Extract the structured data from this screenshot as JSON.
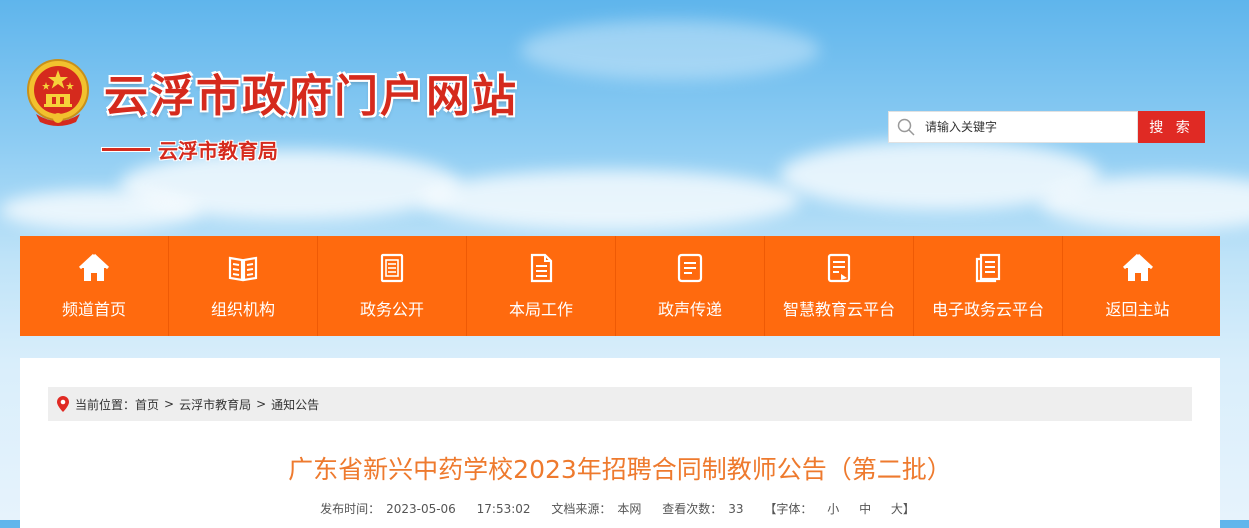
{
  "header": {
    "site_title": "云浮市政府门户网站",
    "sub_title": "云浮市教育局"
  },
  "search": {
    "placeholder": "请输入关键字",
    "button_label": "搜 索"
  },
  "nav": {
    "items": [
      {
        "label": "频道首页",
        "icon": "home-icon"
      },
      {
        "label": "组织机构",
        "icon": "book-icon"
      },
      {
        "label": "政务公开",
        "icon": "document-list-icon"
      },
      {
        "label": "本局工作",
        "icon": "file-text-icon"
      },
      {
        "label": "政声传递",
        "icon": "file-lines-icon"
      },
      {
        "label": "智慧教育云平台",
        "icon": "notepad-icon"
      },
      {
        "label": "电子政务云平台",
        "icon": "stacked-pages-icon"
      },
      {
        "label": "返回主站",
        "icon": "home-icon"
      }
    ]
  },
  "breadcrumb": {
    "prefix": "当前位置：",
    "items": [
      "首页",
      "云浮市教育局",
      "通知公告"
    ],
    "separator": ">"
  },
  "article": {
    "title": "广东省新兴中药学校2023年招聘合同制教师公告（第二批）",
    "meta": {
      "published_label": "发布时间：",
      "published_date": "2023-05-06",
      "published_time": "17:53:02",
      "source_label": "文档来源：",
      "source": "本网",
      "views_label": "查看次数：",
      "views": "33",
      "font_label": "【字体：",
      "font_small": "小",
      "font_medium": "中",
      "font_large": "大】"
    }
  },
  "colors": {
    "brand_red": "#d52a1d",
    "nav_orange": "#ff6a0e",
    "search_red": "#e02a24",
    "title_orange": "#ee7a2e"
  }
}
